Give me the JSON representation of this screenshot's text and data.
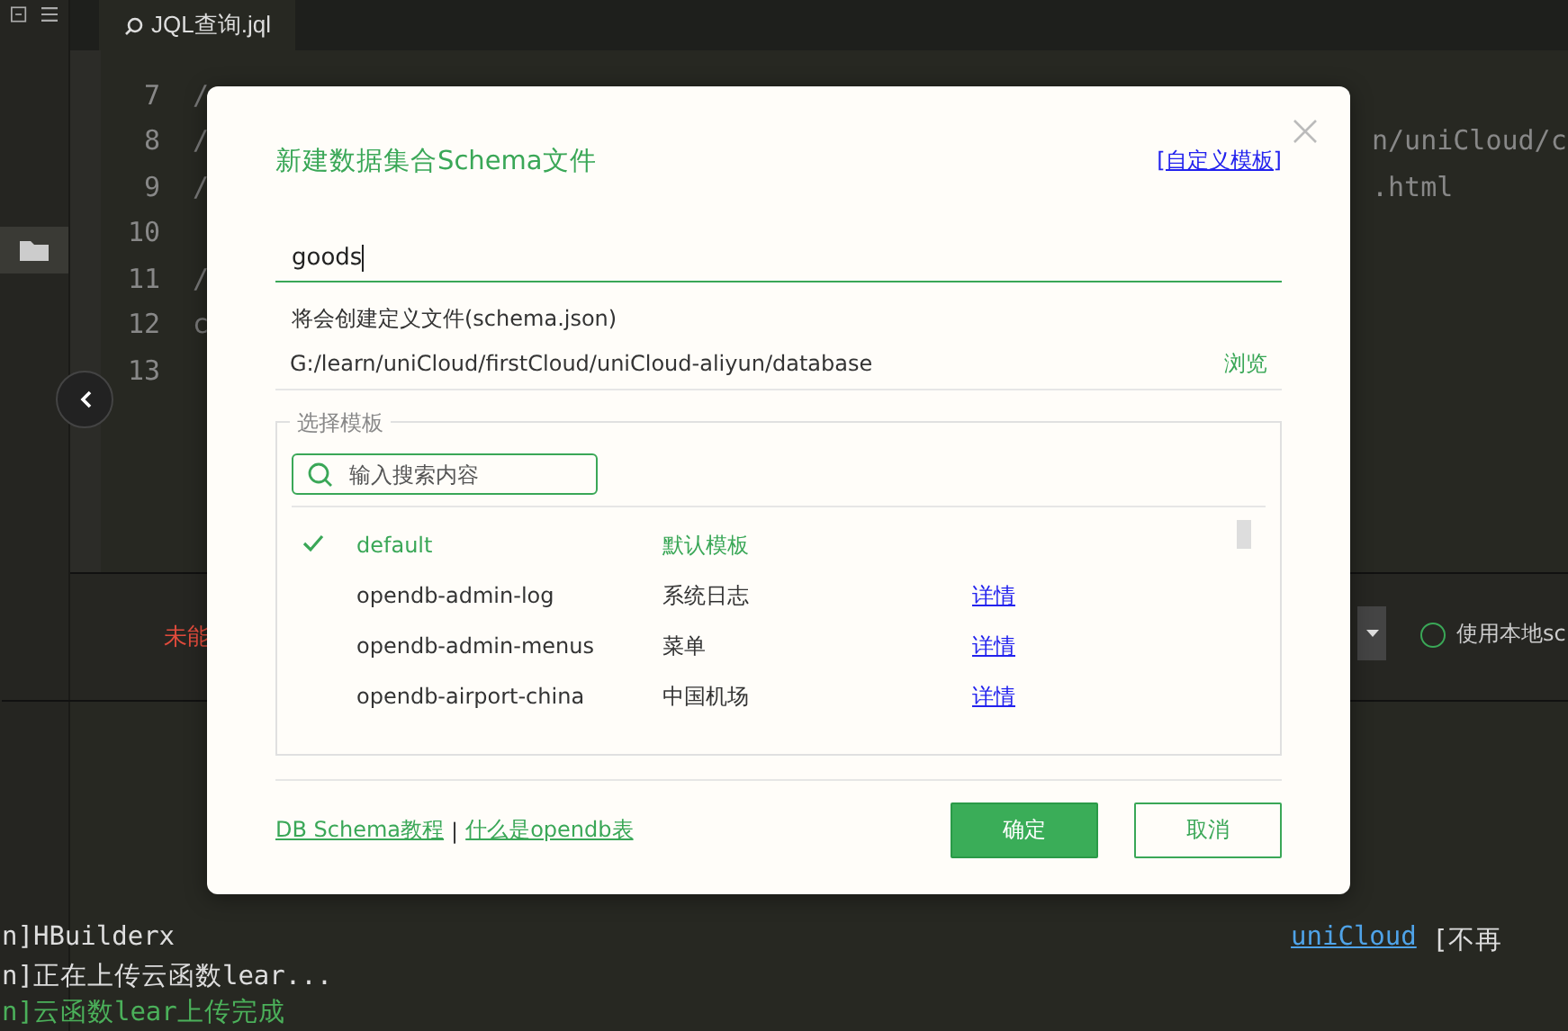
{
  "editor": {
    "tab": "JQL查询.jql",
    "lines": [
      {
        "number": "7",
        "text": "/"
      },
      {
        "number": "8",
        "text": "/"
      },
      {
        "number": "9",
        "text": "/"
      },
      {
        "number": "10"
      },
      {
        "number": "11",
        "text": "/"
      },
      {
        "number": "12",
        "text": "c"
      },
      {
        "number": "13"
      }
    ],
    "right_fragments": [
      "n/uniCloud/c",
      ".html"
    ]
  },
  "bottom_bar": {
    "error_text": "未能",
    "radio_label": "使用本地sc",
    "radio_selected": false
  },
  "console": [
    {
      "kind": "mixed",
      "text": "n]HBuilderx",
      "link": "uniCloud",
      "tail": "[不再"
    },
    {
      "kind": "plain",
      "text": "n]正在上传云函数lear..."
    },
    {
      "kind": "success",
      "text": "n]云函数lear上传完成"
    }
  ],
  "dialog": {
    "title": "新建数据集合Schema文件",
    "custom_template_link": "[自定义模板]",
    "name_value": "goods",
    "hint": "将会创建定义文件(schema.json)",
    "path": "G:/learn/uniCloud/firstCloud/uniCloud-aliyun/database",
    "browse": "浏览",
    "template_group": "选择模板",
    "search_placeholder": "输入搜索内容",
    "templates": [
      {
        "name": "default",
        "description": "默认模板",
        "selected": true
      },
      {
        "name": "opendb-admin-log",
        "description": "系统日志",
        "details": "详情",
        "selected": false
      },
      {
        "name": "opendb-admin-menus",
        "description": "菜单",
        "details": "详情",
        "selected": false
      },
      {
        "name": "opendb-airport-china",
        "description": "中国机场",
        "details": "详情",
        "selected": false
      }
    ],
    "footer_links": [
      "DB Schema教程",
      "什么是opendb表"
    ],
    "footer_separator": "|",
    "buttons": [
      {
        "label": "确定",
        "kind": "primary"
      },
      {
        "label": "取消",
        "kind": "secondary"
      }
    ]
  }
}
